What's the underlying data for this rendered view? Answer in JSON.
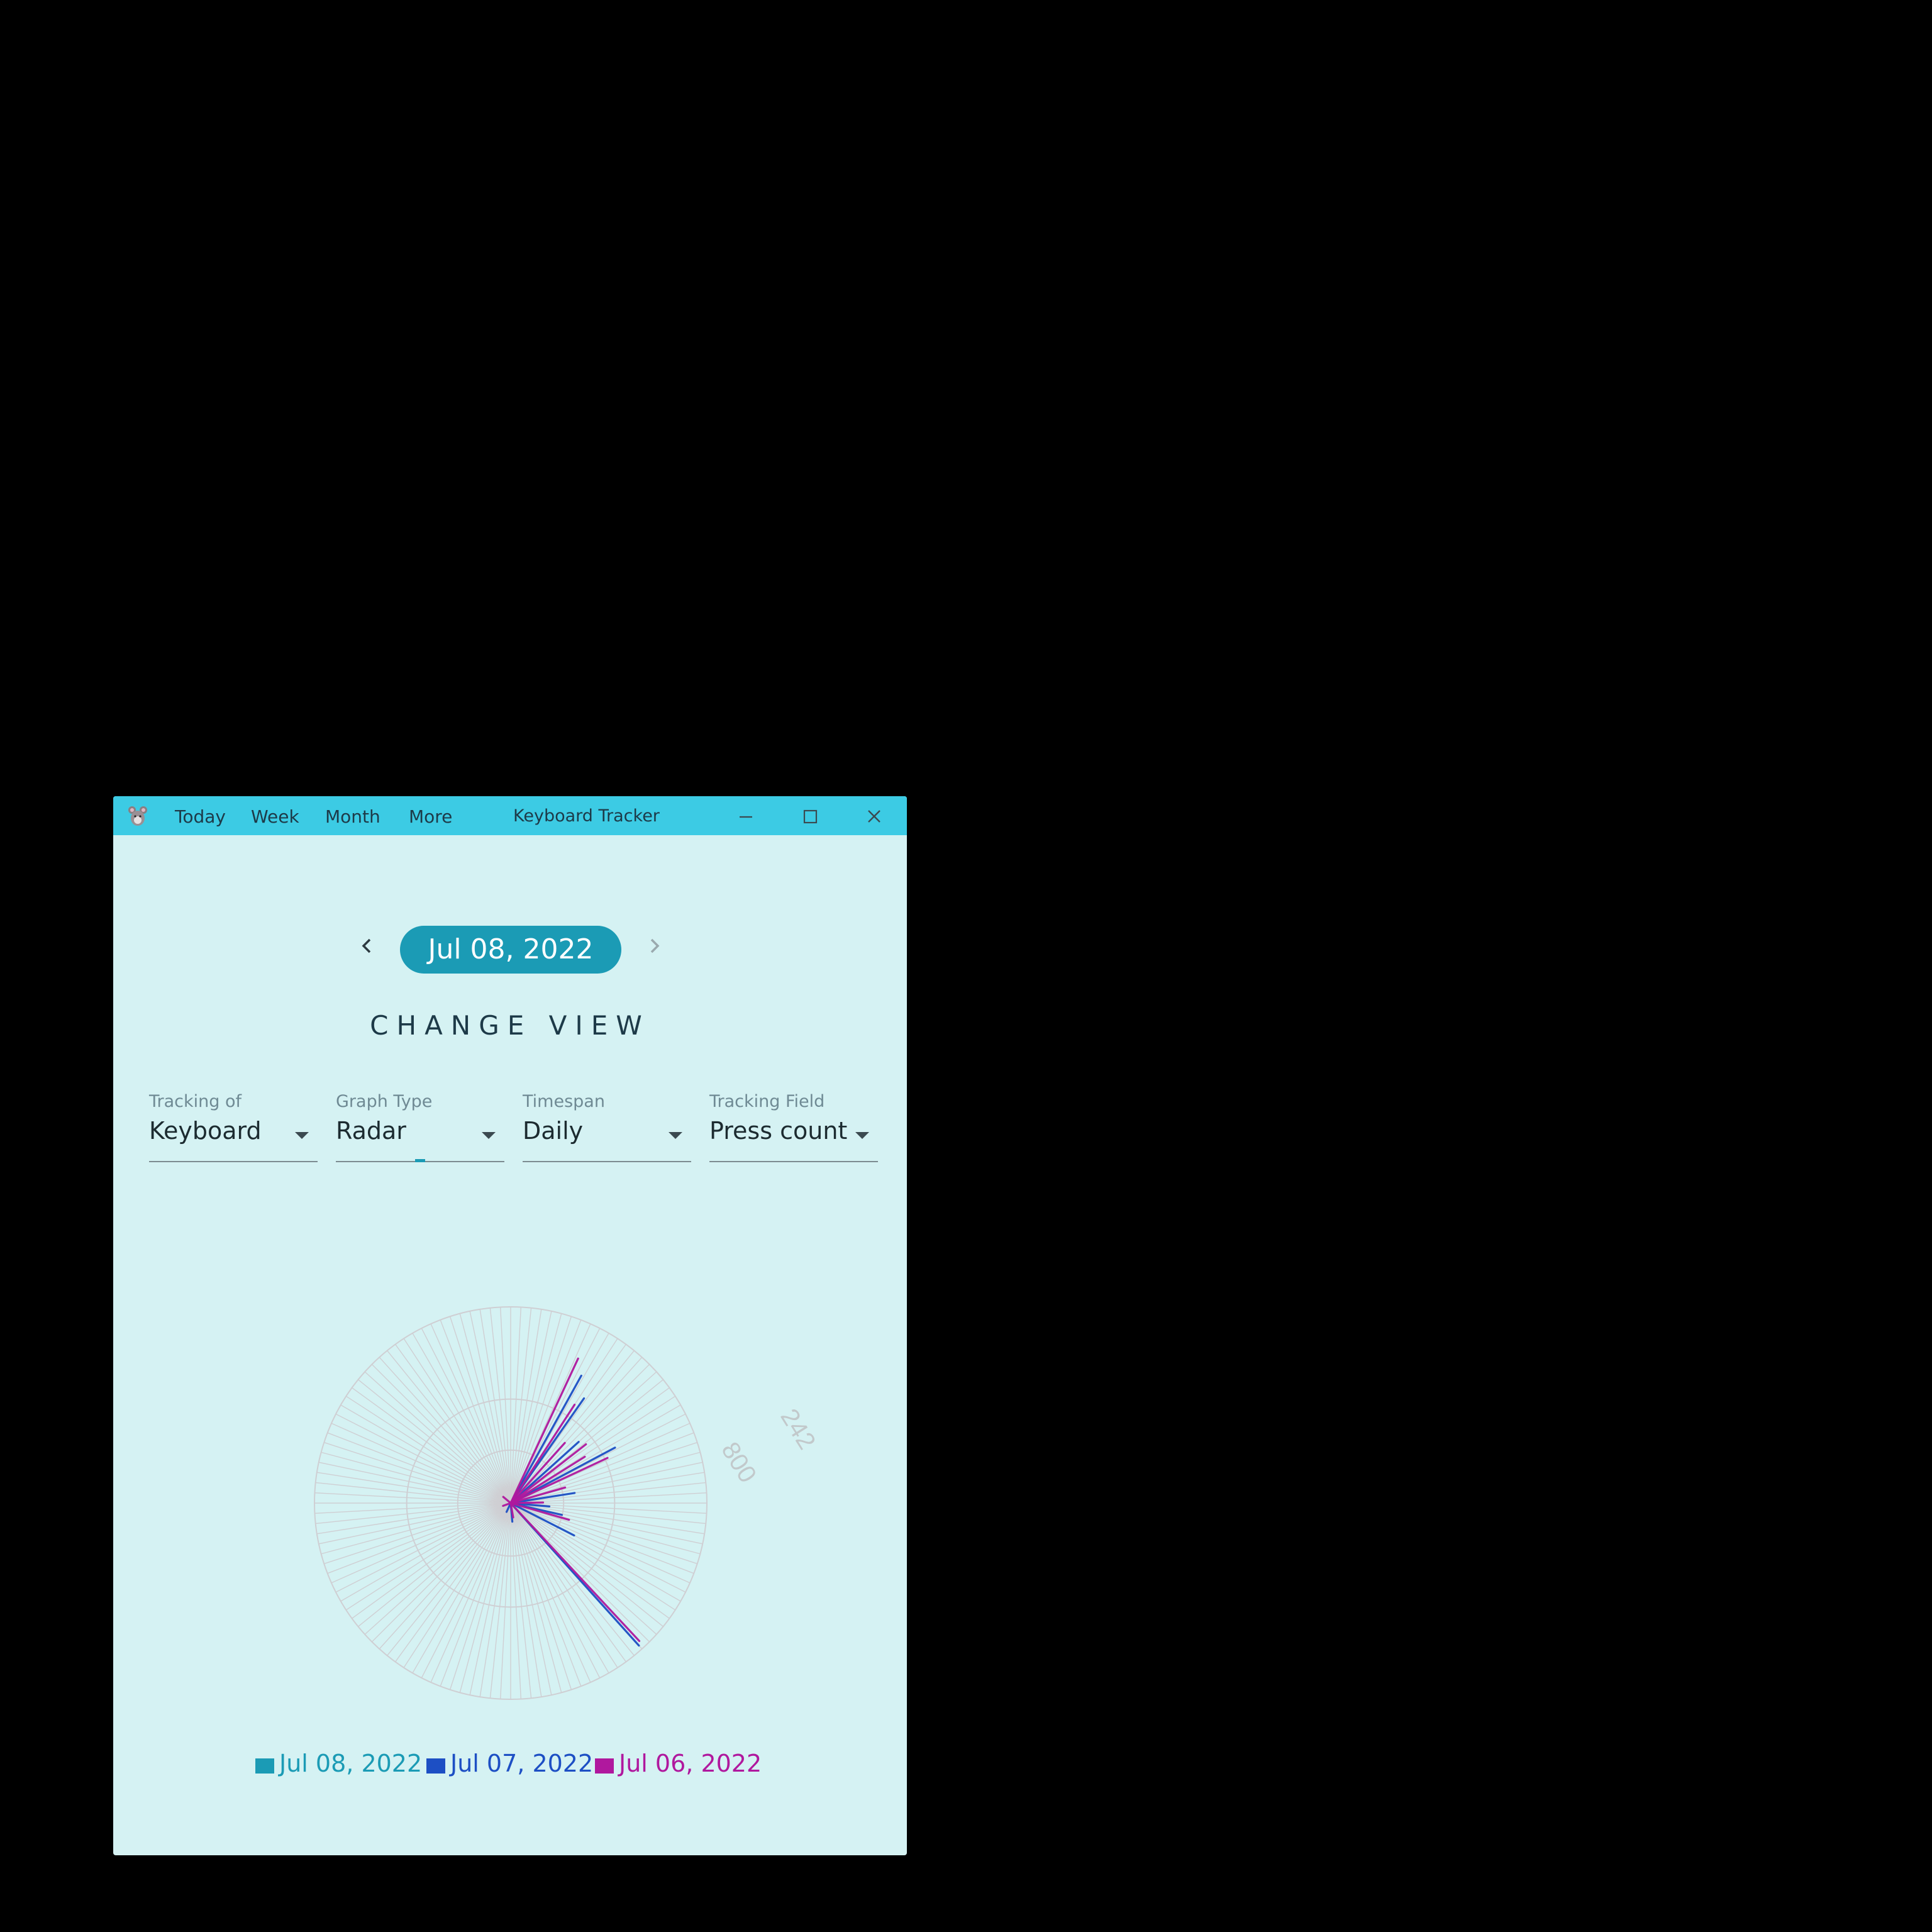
{
  "window": {
    "title": "Keyboard Tracker",
    "menu": [
      "Today",
      "Week",
      "Month",
      "More"
    ]
  },
  "date_nav": {
    "current_date": "Jul 08, 2022"
  },
  "section_title": "CHANGE VIEW",
  "dropdowns": [
    {
      "label": "Tracking of",
      "value": "Keyboard"
    },
    {
      "label": "Graph Type",
      "value": "Radar"
    },
    {
      "label": "Timespan",
      "value": "Daily"
    },
    {
      "label": "Tracking Field",
      "value": "Press count"
    }
  ],
  "colors": {
    "titlebar": "#3ccbe4",
    "background": "#d5f2f3",
    "accent": "#1b9bb5"
  },
  "chart_data": {
    "type": "radar",
    "radial_ticks": [
      "242",
      "800"
    ],
    "rmax": 2424,
    "spokes": 120,
    "series": [
      {
        "name": "Jul 08, 2022",
        "color": "#1b9bb5",
        "values": []
      },
      {
        "name": "Jul 07, 2022",
        "color": "#1d4fc4",
        "values": [
          {
            "angle": 29,
            "value": 1800
          },
          {
            "angle": 35,
            "value": 1580
          },
          {
            "angle": 48,
            "value": 1130
          },
          {
            "angle": 62,
            "value": 1460
          },
          {
            "angle": 81,
            "value": 800
          },
          {
            "angle": 95,
            "value": 480
          },
          {
            "angle": 103,
            "value": 650
          },
          {
            "angle": 117,
            "value": 880
          },
          {
            "angle": 138,
            "value": 2368
          },
          {
            "angle": 175,
            "value": 230
          },
          {
            "angle": 205,
            "value": 120
          }
        ]
      },
      {
        "name": "Jul 06, 2022",
        "color": "#b0189e",
        "values": [
          {
            "angle": 25,
            "value": 1970
          },
          {
            "angle": 33,
            "value": 1450
          },
          {
            "angle": 42,
            "value": 1000
          },
          {
            "angle": 52,
            "value": 1180
          },
          {
            "angle": 58,
            "value": 1080
          },
          {
            "angle": 65,
            "value": 1320
          },
          {
            "angle": 74,
            "value": 700
          },
          {
            "angle": 89,
            "value": 400
          },
          {
            "angle": 106,
            "value": 750
          },
          {
            "angle": 137,
            "value": 2330
          },
          {
            "angle": 170,
            "value": 180
          },
          {
            "angle": 250,
            "value": 100
          },
          {
            "angle": 310,
            "value": 120
          }
        ]
      }
    ]
  }
}
